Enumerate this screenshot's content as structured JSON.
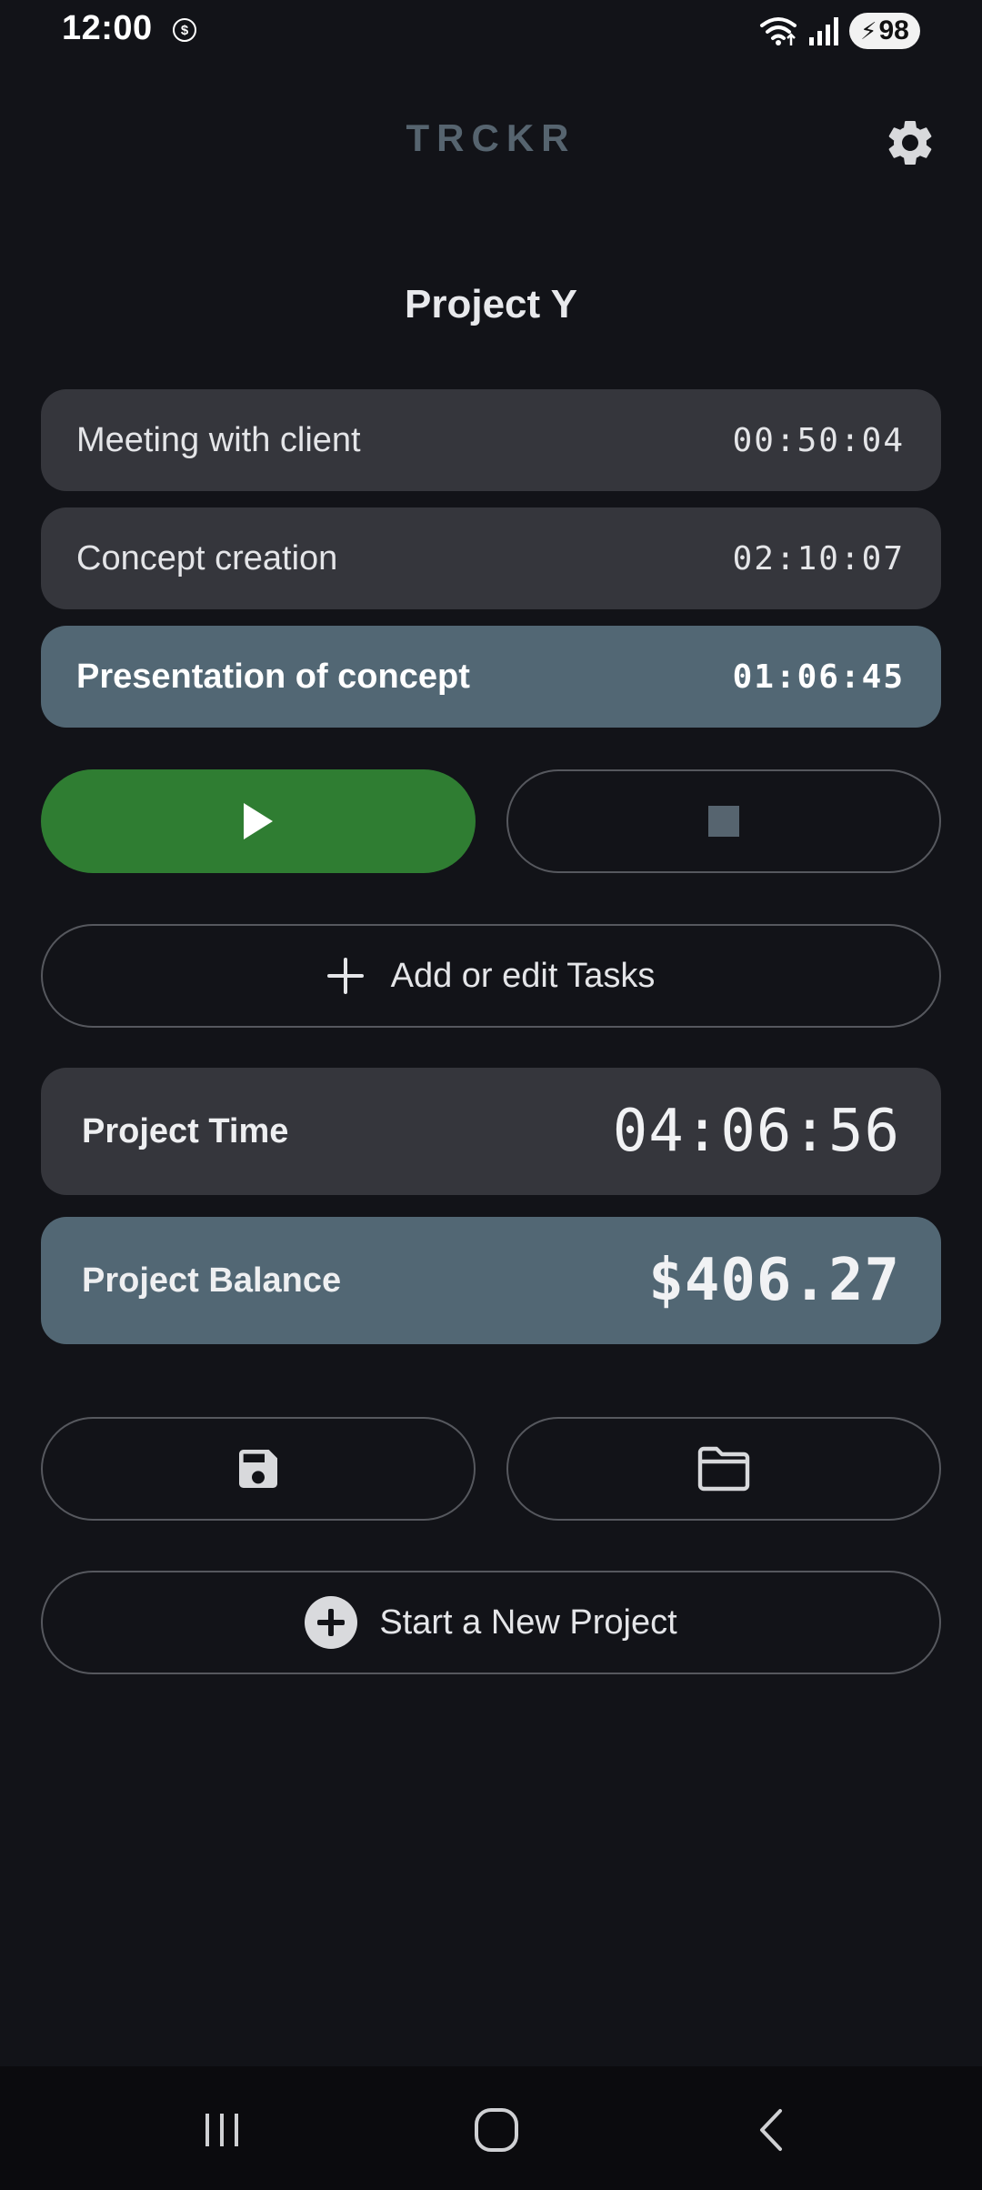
{
  "status_bar": {
    "time": "12:00",
    "app_icon_glyph": "$",
    "battery_level": "98"
  },
  "header": {
    "app_title": "TRCKR",
    "settings_icon": "gear-icon"
  },
  "project": {
    "name": "Project Y"
  },
  "tasks": [
    {
      "name": "Meeting with client",
      "time": "00:50:04",
      "active": false
    },
    {
      "name": "Concept creation",
      "time": "02:10:07",
      "active": false
    },
    {
      "name": "Presentation of concept",
      "time": "01:06:45",
      "active": true
    }
  ],
  "controls": {
    "play_icon": "play-icon",
    "stop_icon": "stop-icon",
    "add_tasks_label": "Add or edit Tasks"
  },
  "summary": {
    "time_label": "Project Time",
    "time_value": "04:06:56",
    "balance_label": "Project Balance",
    "balance_value": "$406.27"
  },
  "file_actions": {
    "save_icon": "save-icon",
    "open_icon": "folder-icon",
    "new_project_label": "Start a New Project"
  },
  "colors": {
    "background": "#121318",
    "card": "#35363c",
    "active_card": "#526774",
    "play_green": "#2f7d32",
    "title_accent": "#56646f"
  }
}
